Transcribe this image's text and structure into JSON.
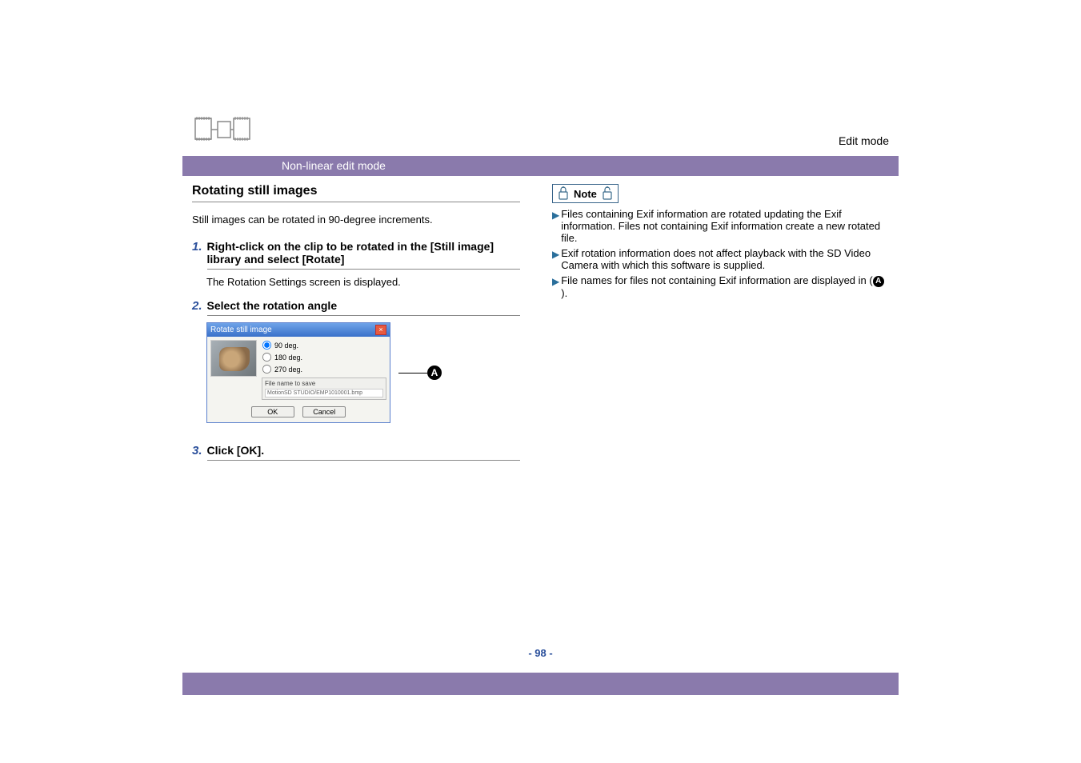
{
  "header": {
    "mode": "Edit mode",
    "section": "Non-linear edit mode"
  },
  "topic": {
    "title": "Rotating still images",
    "intro": "Still images can be rotated in 90-degree increments."
  },
  "steps": [
    {
      "num": "1.",
      "title": "Right-click on the clip to be rotated in the [Still image] library and select [Rotate]",
      "desc": "The Rotation Settings screen is displayed."
    },
    {
      "num": "2.",
      "title": "Select the rotation angle",
      "desc": ""
    },
    {
      "num": "3.",
      "title": "Click [OK].",
      "desc": ""
    }
  ],
  "dialog": {
    "title": "Rotate still image",
    "options": {
      "deg90": "90 deg.",
      "deg180": "180 deg.",
      "deg270": "270 deg."
    },
    "filesave_label": "File name to save",
    "filesave_path": "MotionSD STUDIO/EMP1010001.bmp",
    "ok": "OK",
    "cancel": "Cancel"
  },
  "markers": {
    "a": "A"
  },
  "note": {
    "label": "Note",
    "items": [
      "Files containing Exif information are rotated updating the Exif information. Files not containing Exif information create a new rotated file.",
      "Exif rotation information does not affect playback with the SD Video Camera with which this software is supplied.",
      "File names for files not containing Exif information are displayed in ("
    ],
    "item3_tail": ")."
  },
  "page_number": "- 98 -"
}
